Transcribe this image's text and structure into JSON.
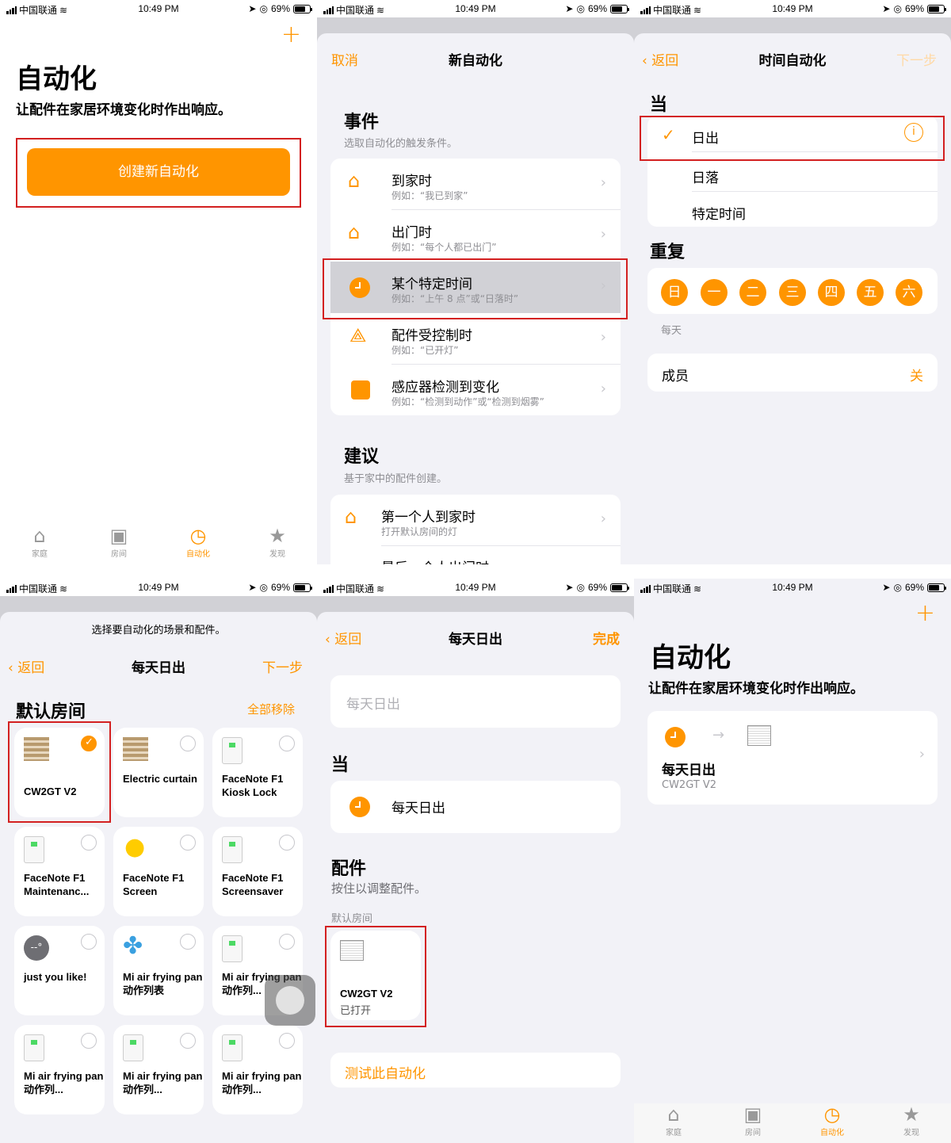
{
  "status_bar": {
    "carrier": "中国联通",
    "time": "10:49 PM",
    "battery": "69%"
  },
  "s1": {
    "title": "自动化",
    "subtitle": "让配件在家居环境变化时作出响应。",
    "create_button": "创建新自动化",
    "add_icon": "+",
    "tabs": [
      {
        "label": "家庭",
        "icon": "house-icon"
      },
      {
        "label": "房间",
        "icon": "room-icon"
      },
      {
        "label": "自动化",
        "icon": "automation-icon"
      },
      {
        "label": "发现",
        "icon": "star-icon"
      }
    ]
  },
  "s2": {
    "nav": {
      "cancel": "取消",
      "title": "新自动化"
    },
    "events_header": "事件",
    "events_sub": "选取自动化的触发条件。",
    "events": [
      {
        "title": "到家时",
        "example": "例如：“我已到家”"
      },
      {
        "title": "出门时",
        "example": "例如：“每个人都已出门”"
      },
      {
        "title": "某个特定时间",
        "example": "例如：“上午 8 点”或“日落时”"
      },
      {
        "title": "配件受控制时",
        "example": "例如：“已开灯”"
      },
      {
        "title": "感应器检测到变化",
        "example": "例如：“检测到动作”或“检测到烟雾”"
      }
    ],
    "suggest_header": "建议",
    "suggest_sub": "基于家中的配件创建。",
    "suggestions": [
      {
        "title": "第一个人到家时",
        "example": "打开默认房间的灯"
      },
      {
        "title": "最后一个人出门时"
      }
    ]
  },
  "s3": {
    "nav": {
      "back": "返回",
      "title": "时间自动化",
      "next": "下一步"
    },
    "when_header": "当",
    "options": [
      "日出",
      "日落",
      "特定时间"
    ],
    "repeat_header": "重复",
    "days": [
      "日",
      "一",
      "二",
      "三",
      "四",
      "五",
      "六"
    ],
    "repeat_caption": "每天",
    "people_label": "成员",
    "people_value": "关"
  },
  "s4": {
    "prompt": "选择要自动化的场景和配件。",
    "nav": {
      "back": "返回",
      "title": "每天日出",
      "next": "下一步"
    },
    "room": "默认房间",
    "remove_all": "全部移除",
    "tiles": [
      {
        "name": "CW2GT V2",
        "selected": true,
        "icon": "curtain-icon"
      },
      {
        "name": "Electric curtain",
        "selected": false,
        "icon": "curtain-icon"
      },
      {
        "name": "FaceNote F1 Kiosk Lock",
        "selected": false,
        "icon": "switch-icon"
      },
      {
        "name": "FaceNote F1 Maintenanc...",
        "selected": false,
        "icon": "switch-icon"
      },
      {
        "name": "FaceNote F1 Screen",
        "selected": false,
        "icon": "bulb-icon"
      },
      {
        "name": "FaceNote F1 Screensaver",
        "selected": false,
        "icon": "switch-icon"
      },
      {
        "name": "just you like!",
        "selected": false,
        "icon": "scene-icon"
      },
      {
        "name": "Mi air frying pan 动作列表",
        "selected": false,
        "icon": "fan-icon"
      },
      {
        "name": "Mi air frying pan 动作列...",
        "selected": false,
        "icon": "switch-icon"
      },
      {
        "name": "Mi air frying pan 动作列...",
        "selected": false,
        "icon": "switch-icon"
      },
      {
        "name": "Mi air frying pan 动作列...",
        "selected": false,
        "icon": "switch-icon"
      },
      {
        "name": "Mi air frying pan 动作列...",
        "selected": false,
        "icon": "switch-icon"
      }
    ]
  },
  "s5": {
    "nav": {
      "back": "返回",
      "title": "每天日出",
      "done": "完成"
    },
    "name_placeholder": "每天日出",
    "when_header": "当",
    "trigger": "每天日出",
    "acc_header": "配件",
    "acc_sub": "按住以调整配件。",
    "room": "默认房间",
    "acc_name": "CW2GT V2",
    "acc_state": "已打开",
    "test": "测试此自动化"
  },
  "s6": {
    "title": "自动化",
    "subtitle": "让配件在家居环境变化时作出响应。",
    "add_icon": "+",
    "card_title": "每天日出",
    "card_sub": "CW2GT V2",
    "tabs": [
      {
        "label": "家庭"
      },
      {
        "label": "房间"
      },
      {
        "label": "自动化"
      },
      {
        "label": "发现"
      }
    ]
  }
}
